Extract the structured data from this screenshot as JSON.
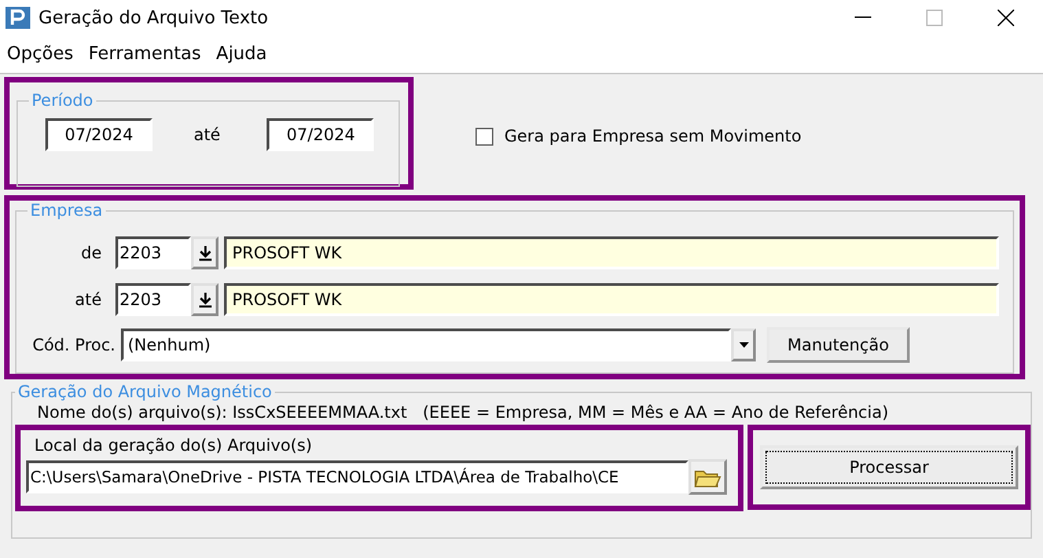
{
  "window": {
    "title": "Geração do Arquivo Texto"
  },
  "menu": [
    "Opções",
    "Ferramentas",
    "Ajuda"
  ],
  "periodo": {
    "legend": "Período",
    "from": "07/2024",
    "separator": "até",
    "to": "07/2024"
  },
  "sem_movimento": {
    "label": "Gera para Empresa sem Movimento",
    "checked": false
  },
  "empresa": {
    "legend": "Empresa",
    "rows": [
      {
        "label": "de",
        "code": "2203",
        "name": "PROSOFT WK"
      },
      {
        "label": "até",
        "code": "2203",
        "name": "PROSOFT WK"
      }
    ],
    "proc_label": "Cód. Proc.",
    "proc_value": "(Nenhum)",
    "maint_button": "Manutenção"
  },
  "geracao": {
    "legend": "Geração do Arquivo Magnético",
    "file_name": "Nome do(s) arquivo(s): IssCxSEEEEMMAA.txt   (EEEE = Empresa, MM = Mês e AA = Ano de Referência)",
    "local_label": "Local da geração do(s) Arquivo(s)",
    "path": "C:\\Users\\Samara\\OneDrive - PISTA TECNOLOGIA LTDA\\Área de Trabalho\\CE",
    "process_button": "Processar"
  }
}
